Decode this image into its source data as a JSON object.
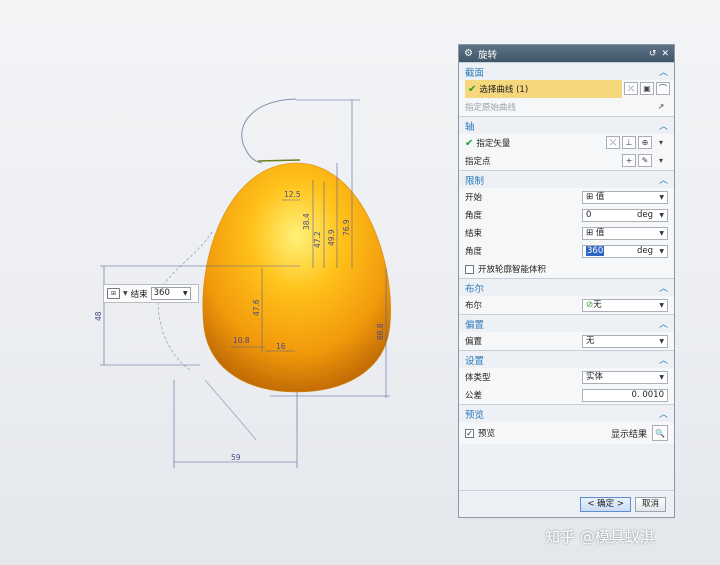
{
  "viewport": {
    "mini_toolbar": {
      "end_label": "结束",
      "end_value": "360"
    },
    "dimensions": [
      "12.5",
      "38.4",
      "47.2",
      "49.9",
      "76.9",
      "48",
      "47.6",
      "10.8",
      "16",
      "68.8",
      "59"
    ]
  },
  "dialog": {
    "title": "旋转",
    "sections": {
      "section_curve": {
        "title": "截面",
        "select_curve": "选择曲线 (1)",
        "origin_curve": "指定原始曲线"
      },
      "axis": {
        "title": "轴",
        "vector": "指定矢量",
        "point": "指定点"
      },
      "limits": {
        "title": "限制",
        "start_label": "开始",
        "start_value": "值",
        "angle1_label": "角度",
        "angle1_value": "0",
        "angle1_unit": "deg",
        "end_label": "结束",
        "end_value": "值",
        "angle2_label": "角度",
        "angle2_value": "360",
        "angle2_unit": "deg",
        "open_profile": "开放轮廓智能体积"
      },
      "boolean": {
        "title": "布尔",
        "label": "布尔",
        "value": "无"
      },
      "offset": {
        "title": "偏置",
        "label": "偏置",
        "value": "无"
      },
      "settings": {
        "title": "设置",
        "body_type_label": "体类型",
        "body_type_value": "实体",
        "tolerance_label": "公差",
        "tolerance_value": "0. 0010"
      },
      "preview": {
        "title": "预览",
        "checkbox_label": "预览",
        "show_result": "显示结果"
      }
    },
    "ok_label": "< 确定 >",
    "cancel_label": "取消"
  },
  "watermark": "知乎 @模具蚁淇"
}
